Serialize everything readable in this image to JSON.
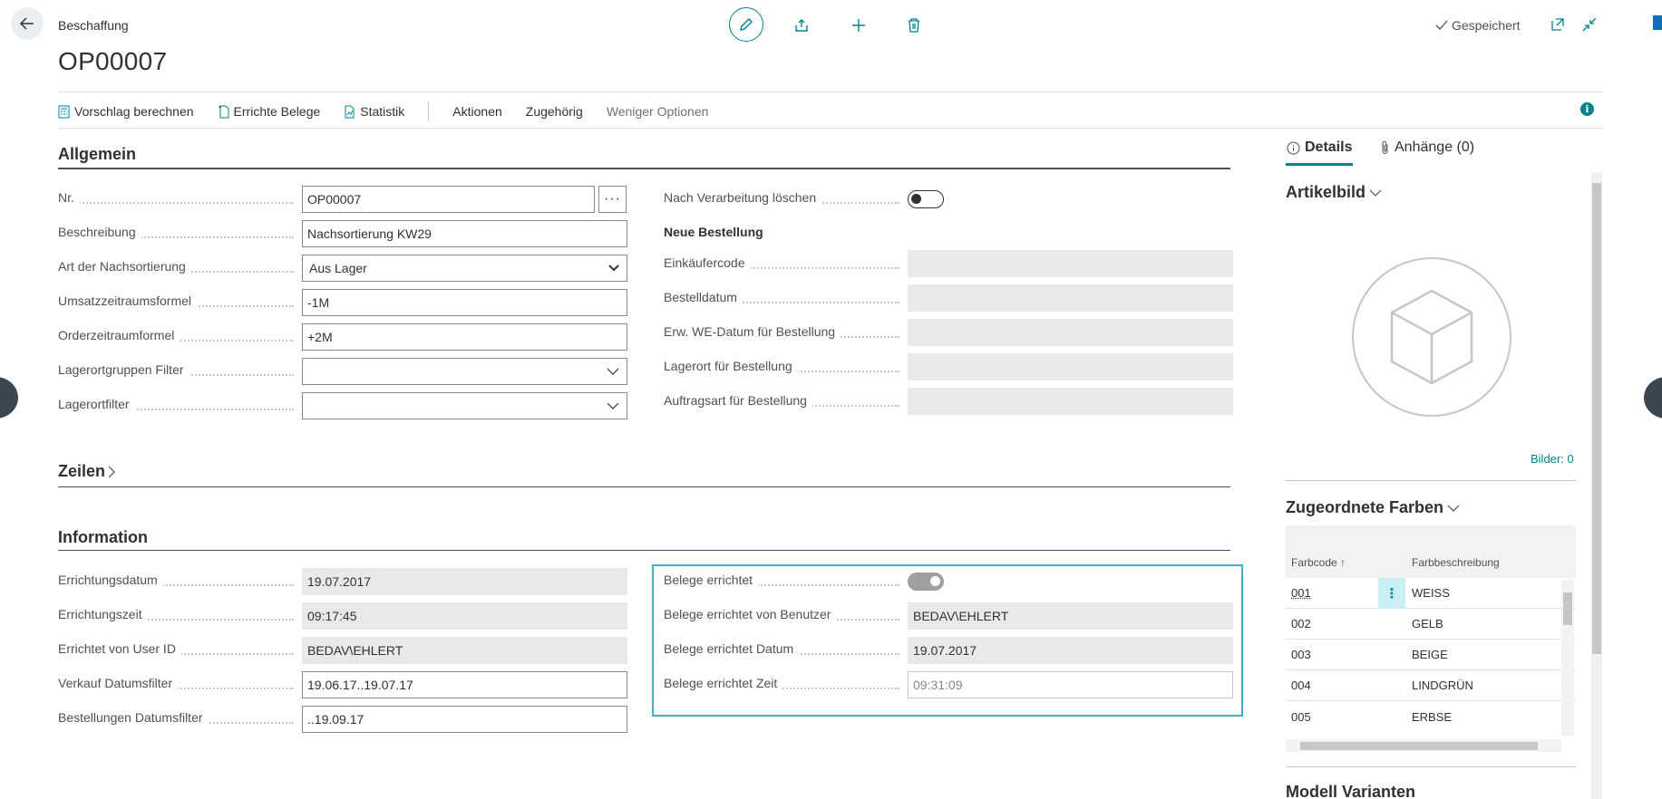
{
  "header": {
    "breadcrumb": "Beschaffung",
    "title": "OP00007",
    "saved_label": "Gespeichert"
  },
  "toolbar": {
    "items": [
      {
        "label": "Vorschlag berechnen",
        "icon": "calculator-icon"
      },
      {
        "label": "Errichte Belege",
        "icon": "new-document-icon"
      },
      {
        "label": "Statistik",
        "icon": "chart-document-icon"
      }
    ],
    "menus": [
      "Aktionen",
      "Zugehörig",
      "Weniger Optionen"
    ]
  },
  "allgemein": {
    "title": "Allgemein",
    "fields": {
      "nr": {
        "label": "Nr.",
        "value": "OP00007"
      },
      "beschreibung": {
        "label": "Beschreibung",
        "value": "Nachsortierung KW29"
      },
      "art": {
        "label": "Art der Nachsortierung",
        "value": "Aus Lager"
      },
      "umsatz": {
        "label": "Umsatzzeitraumsformel",
        "value": "-1M"
      },
      "order": {
        "label": "Orderzeitraumformel",
        "value": "+2M"
      },
      "lagerortgruppen": {
        "label": "Lagerortgruppen Filter",
        "value": ""
      },
      "lagerortfilter": {
        "label": "Lagerortfilter",
        "value": ""
      }
    },
    "right": {
      "nach_verarbeitung": {
        "label": "Nach Verarbeitung löschen",
        "checked": false
      },
      "neue_bestellung": "Neue Bestellung",
      "einkaeufercode": {
        "label": "Einkäufercode",
        "value": ""
      },
      "bestelldatum": {
        "label": "Bestelldatum",
        "value": ""
      },
      "we_datum": {
        "label": "Erw. WE-Datum für Bestellung",
        "value": ""
      },
      "lagerort": {
        "label": "Lagerort für Bestellung",
        "value": ""
      },
      "auftragsart": {
        "label": "Auftragsart für Bestellung",
        "value": ""
      }
    }
  },
  "zeilen": {
    "title": "Zeilen"
  },
  "information": {
    "title": "Information",
    "fields": {
      "errichtungsdatum": {
        "label": "Errichtungsdatum",
        "value": "19.07.2017"
      },
      "errichtungszeit": {
        "label": "Errichtungszeit",
        "value": "09:17:45"
      },
      "errichtet_von": {
        "label": "Errichtet von User ID",
        "value": "BEDAV\\EHLERT"
      },
      "verkauf_filter": {
        "label": "Verkauf Datumsfilter",
        "value": "19.06.17..19.07.17"
      },
      "bestellungen_filter": {
        "label": "Bestellungen Datumsfilter",
        "value": "..19.09.17"
      }
    },
    "right": {
      "belege_errichtet": {
        "label": "Belege errichtet",
        "checked": true
      },
      "belege_benutzer": {
        "label": "Belege errichtet von Benutzer",
        "value": "BEDAV\\EHLERT"
      },
      "belege_datum": {
        "label": "Belege errichtet Datum",
        "value": "19.07.2017"
      },
      "belege_zeit": {
        "label": "Belege errichtet Zeit",
        "value": "09:31:09"
      }
    }
  },
  "factbox": {
    "tabs": [
      "Details",
      "Anhänge (0)"
    ],
    "artikelbild": {
      "title": "Artikelbild",
      "bilder": "Bilder: 0"
    },
    "farben": {
      "title": "Zugeordnete Farben",
      "columns": [
        "Farbcode ↑",
        "Farbbeschreibung"
      ],
      "rows": [
        {
          "code": "001",
          "desc": "WEISS"
        },
        {
          "code": "002",
          "desc": "GELB"
        },
        {
          "code": "003",
          "desc": "BEIGE"
        },
        {
          "code": "004",
          "desc": "LINDGRÜN"
        },
        {
          "code": "005",
          "desc": "ERBSE"
        }
      ]
    },
    "varianten": {
      "title": "Modell Varianten"
    }
  },
  "colors": {
    "accent": "#008489",
    "focus": "#40b3c7"
  }
}
